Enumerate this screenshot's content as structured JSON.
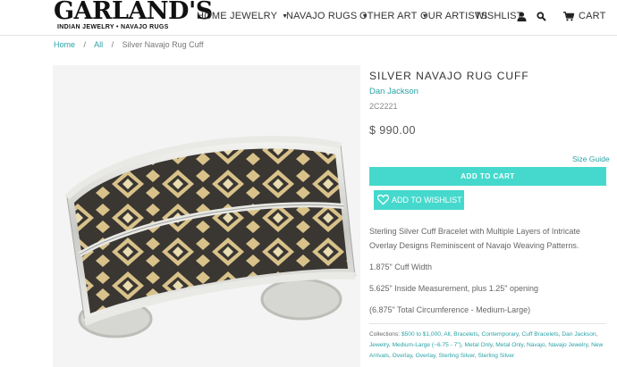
{
  "header": {
    "logo_main": "GARLAND'S",
    "logo_sub": "INDIAN JEWELRY • NAVAJO RUGS",
    "nav": {
      "home": "HOME",
      "jewelry": "JEWELRY",
      "navajo_rugs": "NAVAJO RUGS",
      "other_art": "OTHER ART",
      "our_artists": "OUR ARTISTS",
      "wishlist": "WISHLIST",
      "cart": "CART"
    }
  },
  "breadcrumb": {
    "home": "Home",
    "sep": "/",
    "all": "All",
    "current": "Silver Navajo Rug Cuff"
  },
  "product": {
    "title": "SILVER NAVAJO RUG CUFF",
    "vendor": "Dan Jackson",
    "sku": "2C2221",
    "price": "$ 990.00",
    "size_guide": "Size Guide",
    "add_to_cart": "ADD TO CART",
    "add_to_wishlist": "ADD TO WISHLIST",
    "description": [
      "Sterling Silver Cuff Bracelet with Multiple Layers of Intricate",
      "Overlay Designs Reminiscent of Navajo Weaving Patterns.",
      "1.875\" Cuff Width",
      "5.625\" Inside Measurement, plus 1.25\" opening",
      "(6.875\" Total Circumference - Medium-Large)"
    ],
    "collections_label": "Collections:",
    "collections": [
      "$500 to $1,000",
      "All",
      "Bracelets",
      "Contemporary",
      "Cuff Bracelets",
      "Dan Jackson",
      "Jewelry",
      "Medium-Large (~6.75 - 7\")",
      "Metal Only",
      "Metal Only",
      "Navajo",
      "Navajo Jewelry",
      "New Arrivals",
      "Overlay",
      "Overlay",
      "Sterling Silver",
      "Sterling Silver"
    ]
  },
  "colors": {
    "accent": "#2ba3a6",
    "button": "#45d9cd"
  }
}
